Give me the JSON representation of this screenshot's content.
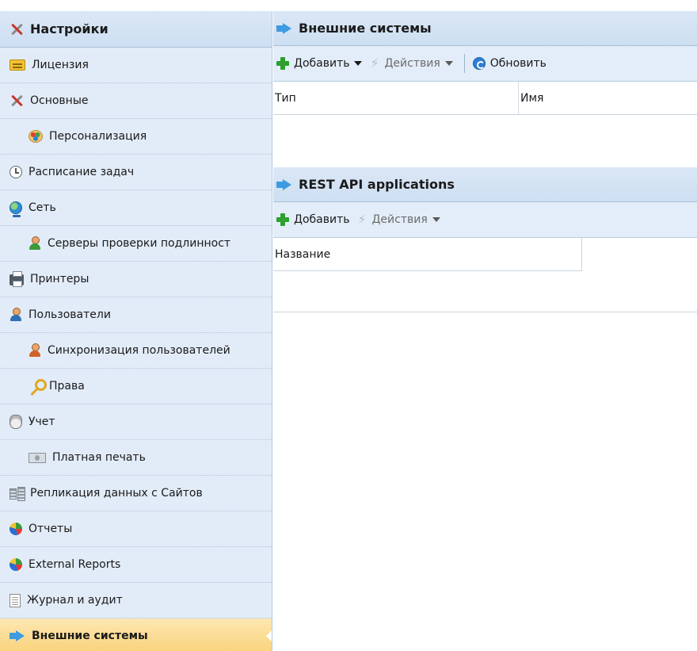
{
  "sidebar": {
    "title": "Настройки",
    "title_icon": "tools-icon",
    "items": [
      {
        "label": "Лицензия",
        "icon": "license-icon",
        "sub": false
      },
      {
        "label": "Основные",
        "icon": "tools-icon",
        "sub": false
      },
      {
        "label": "Персонализация",
        "icon": "palette-icon",
        "sub": true
      },
      {
        "label": "Расписание задач",
        "icon": "clock-icon",
        "sub": false
      },
      {
        "label": "Сеть",
        "icon": "globe-icon",
        "sub": false
      },
      {
        "label": "Серверы проверки подлинност",
        "icon": "user-green-icon",
        "sub": true
      },
      {
        "label": "Принтеры",
        "icon": "printer-icon",
        "sub": false
      },
      {
        "label": "Пользователи",
        "icon": "user-icon",
        "sub": false
      },
      {
        "label": "Синхронизация пользователей",
        "icon": "user-orange-icon",
        "sub": true
      },
      {
        "label": "Права",
        "icon": "key-icon",
        "sub": true
      },
      {
        "label": "Учет",
        "icon": "moneybag-icon",
        "sub": false
      },
      {
        "label": "Платная печать",
        "icon": "bill-icon",
        "sub": true
      },
      {
        "label": "Репликация данных с Сайтов",
        "icon": "replicate-icon",
        "sub": false
      },
      {
        "label": "Отчеты",
        "icon": "pie-chart-icon",
        "sub": false
      },
      {
        "label": "External Reports",
        "icon": "pie-chart-icon",
        "sub": false
      },
      {
        "label": "Журнал и аудит",
        "icon": "log-icon",
        "sub": false
      },
      {
        "label": "Внешние системы",
        "icon": "arrow-right-icon",
        "sub": false,
        "active": true
      }
    ]
  },
  "panel1": {
    "title": "Внешние системы",
    "toolbar": {
      "add_label": "Добавить",
      "actions_label": "Действия",
      "refresh_label": "Обновить"
    },
    "columns": [
      "Тип",
      "Имя"
    ]
  },
  "panel2": {
    "title": "REST API applications",
    "toolbar": {
      "add_label": "Добавить",
      "actions_label": "Действия"
    },
    "columns": [
      "Название"
    ]
  },
  "colors": {
    "sidebar_bg": "#e2ecf8",
    "header_bg": "#cddff2",
    "active_bg": "#f9d27a",
    "accent_arrow": "#3e9be0"
  }
}
